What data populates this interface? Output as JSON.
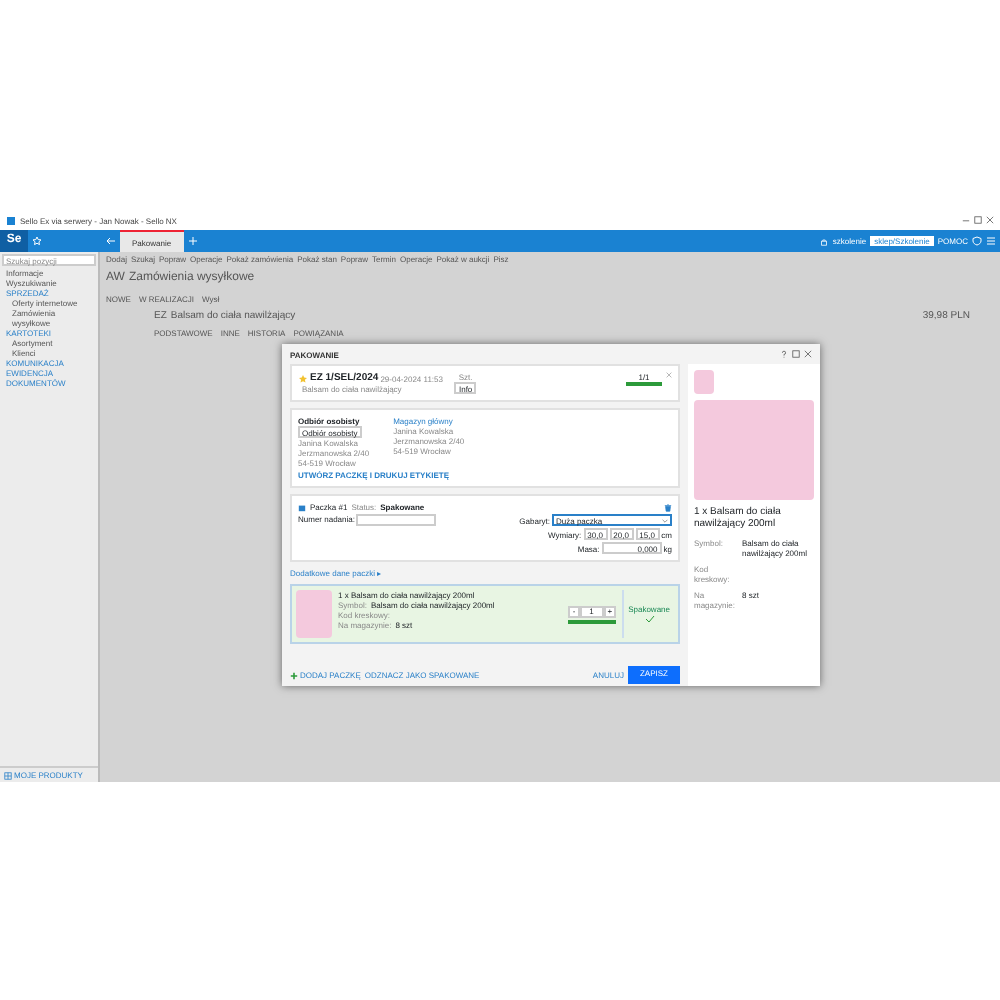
{
  "window": {
    "title": "Sello Ex via serwery - Jan Nowak - Sello NX"
  },
  "topbar": {
    "logo": "Se",
    "tabs": [
      {
        "label": "Pakowanie",
        "selected": true
      }
    ],
    "user": "szkolenie",
    "account": "sklep/Szkolenie",
    "help": "POMOC"
  },
  "toolbar": [
    "Dodaj",
    "Szukaj",
    "Popraw",
    "Operacje",
    "Pokaż zamówienia",
    "Pokaż stan",
    "Popraw",
    "Termin",
    "Operacje",
    "Pokaż w aukcji",
    "Pisz"
  ],
  "sidebar": {
    "placeholder": "Szukaj pozycji",
    "items": [
      {
        "label": "Informacje",
        "kind": "item"
      },
      {
        "label": "Wyszukiwanie",
        "kind": "item"
      },
      {
        "label": "SPRZEDAŻ",
        "kind": "section"
      },
      {
        "label": "Oferty internetowe",
        "kind": "sub"
      },
      {
        "label": "Zamówienia wysyłkowe",
        "kind": "sub"
      },
      {
        "label": "KARTOTEKI",
        "kind": "section"
      },
      {
        "label": "Asortyment",
        "kind": "sub"
      },
      {
        "label": "Klienci",
        "kind": "sub"
      },
      {
        "label": "KOMUNIKACJA",
        "kind": "section"
      },
      {
        "label": "EWIDENCJA DOKUMENTÓW",
        "kind": "section"
      }
    ],
    "footer": "MOJE PRODUKTY"
  },
  "background": {
    "badge": "AW",
    "title": "Zamówienia wysyłkowe",
    "tabs": [
      "NOWE",
      "W REALIZACJI",
      "Wysł"
    ],
    "detail_badge": "EZ",
    "detail_title": "Balsam do ciała nawilżający",
    "detail_price": "39,98 PLN",
    "detail_tabs": [
      "PODSTAWOWE",
      "INNE",
      "HISTORIA",
      "POWIĄZANIA"
    ]
  },
  "dialog": {
    "title": "PAKOWANIE",
    "order": {
      "number": "EZ 1/SEL/2024",
      "date": "29-04-2024 11:53",
      "subtitle": "Balsam do ciała nawilżający",
      "unit": "Szt.",
      "info": "Info",
      "count": "1/1",
      "level": 1
    },
    "recipient": {
      "heading": "Odbiór osobisty",
      "chip": "Odbiór osobisty",
      "lines": [
        "Janina Kowalska",
        "Jerzmanowska 2/40",
        "54-519 Wrocław"
      ]
    },
    "sender": {
      "heading": "Magazyn główny",
      "lines": [
        "Janina Kowalska",
        "Jerzmanowska 2/40",
        "54-519 Wrocław"
      ]
    },
    "print_button": "UTWÓRZ PACZKĘ I DRUKUJ ETYKIETĘ",
    "package": {
      "label": "Paczka #1",
      "status_label": "Status:",
      "status": "Spakowane",
      "tracking_label": "Numer nadania:",
      "size_label": "Gabaryt:",
      "size": "Duża paczka",
      "dims_label": "Wymiary:",
      "dims": [
        "30,0",
        "20,0",
        "15,0"
      ],
      "dims_unit": "cm",
      "mass_label": "Masa:",
      "mass": "0,000",
      "mass_unit": "kg",
      "more": "Dodatkowe dane paczki ▸"
    },
    "item": {
      "title": "1 x Balsam do ciała nawilżający 200ml",
      "fields": [
        {
          "label": "Symbol:",
          "value": "Balsam do ciała nawilżający 200ml"
        },
        {
          "label": "Kod kreskowy:"
        },
        {
          "label": "Na magazynie:",
          "value": "8 szt"
        }
      ],
      "minus": "-",
      "qty": "1",
      "plus": "+",
      "level": 1,
      "packed": true,
      "packed_label": "Spakowane"
    },
    "side": {
      "title": "1 x Balsam do ciała nawilżający 200ml",
      "fields": [
        {
          "label": "Symbol:",
          "value": "Balsam do ciała nawilżający 200ml"
        },
        {
          "label": "Kod kreskowy:"
        },
        {
          "label": "Na magazynie:",
          "value": "8 szt"
        }
      ]
    },
    "footer": {
      "add": "DODAJ PACZKĘ",
      "unmark": "ODZNACZ JAKO SPAKOWANE",
      "cancel": "ANULUJ",
      "save": "ZAPISZ"
    }
  }
}
